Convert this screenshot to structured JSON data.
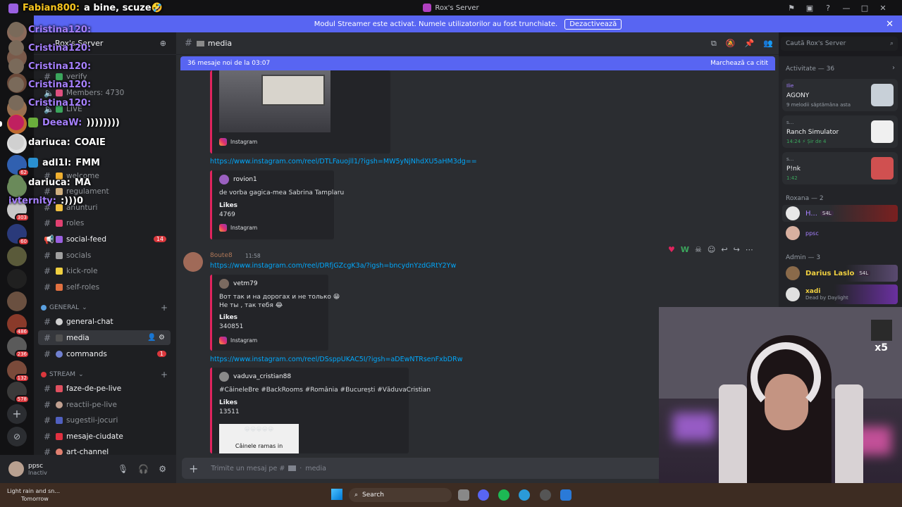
{
  "window": {
    "title": "Rox's Server"
  },
  "banner": {
    "text": "Modul Streamer este activat. Numele utilizatorilor au fost trunchiate.",
    "button": "Dezactivează"
  },
  "server": {
    "name": "Rox's Server"
  },
  "channel_list": {
    "top": [
      {
        "label": "verify"
      },
      {
        "label": "Members: 4730"
      },
      {
        "label": "LIVE"
      },
      {
        "label": "welcome"
      },
      {
        "label": "regulament"
      },
      {
        "label": "anunturi"
      },
      {
        "label": "roles"
      },
      {
        "label": "social-feed",
        "count": "14"
      },
      {
        "label": "socials"
      },
      {
        "label": "kick-role"
      },
      {
        "label": "self-roles"
      }
    ],
    "cat_general": "GENERAL",
    "general": [
      {
        "label": "general-chat"
      },
      {
        "label": "media"
      },
      {
        "label": "commands",
        "count": "1"
      }
    ],
    "cat_stream": "STREAM",
    "stream": [
      {
        "label": "faze-de-pe-live"
      },
      {
        "label": "reactii-pe-live"
      },
      {
        "label": "sugestii-jocuri"
      },
      {
        "label": "mesaje-ciudate"
      },
      {
        "label": "art-channel"
      }
    ]
  },
  "user": {
    "name": "ppsc",
    "status": "Inactiv"
  },
  "chat": {
    "channel": "media",
    "new_messages": "36 mesaje noi de la 03:07",
    "mark_read": "Marchează ca citit",
    "search_placeholder": "Caută Rox's Server",
    "composer_placeholder": "Trimite un mesaj pe #",
    "composer_channel": "media",
    "embed0": {
      "source": "Instagram"
    },
    "link1": "https://www.instagram.com/reel/DTLFauojll1/?igsh=MW5yNjNhdXU5aHM3dg==",
    "embed1": {
      "author": "rovion1",
      "text": "de vorba gagica-mea Sabrina Tamplaru",
      "likes_label": "Likes",
      "likes": "4769",
      "source": "Instagram"
    },
    "msg2": {
      "author": "8oute8",
      "time": "11:58"
    },
    "link2": "https://www.instagram.com/reel/DRfjGZcgK3a/?igsh=bncydnYzdGRtY2Yw",
    "embed2": {
      "author": "vetm79",
      "line1": "Вот так и на дорогах и не только 😁",
      "line2": "Не ты , так тебя 😂",
      "likes_label": "Likes",
      "likes": "340851",
      "source": "Instagram"
    },
    "link3": "https://www.instagram.com/reel/DSsppUKAC5I/?igsh=aDEwNTRsenFxbDRw",
    "embed3": {
      "author": "vaduva_cristian88",
      "text": "#CăineleBre #BackRooms #România #București #VăduvaCristian",
      "likes_label": "Likes",
      "likes": "13511",
      "thumb_emojis": "😀😀😀😀😀",
      "thumb_caption": "Câinele ramas in"
    }
  },
  "members": {
    "activity_header": "Activitate — 36",
    "activities": [
      {
        "user": "Ilie",
        "title": "AGONY",
        "sub": "9 melodii săptămâna asta"
      },
      {
        "user": "s...",
        "title": "Ranch Simulator",
        "sub": "14:24  ⚡ Șir de 4"
      },
      {
        "user": "s...",
        "title": "P!nk",
        "sub": "1:42"
      }
    ],
    "group1": "Roxana — 2",
    "group1_tag": "S4L",
    "group1_m2": "ppsc",
    "group2": "Admin — 3",
    "admin1": "Darius Laslo",
    "admin1_tag": "S4L",
    "admin2": "xadi",
    "admin2_sub": "Dead by Daylight"
  },
  "overlay": [
    {
      "name": "Fabian800:",
      "msg": "a bine, scuze🤣"
    },
    {
      "name": "Cristina120:",
      "msg": ""
    },
    {
      "name": "Cristina120:",
      "msg": ""
    },
    {
      "name": "Cristina120:",
      "msg": ""
    },
    {
      "name": "Cristina120:",
      "msg": ""
    },
    {
      "name": "Cristina120:",
      "msg": ""
    },
    {
      "name": "DeeaW:",
      "msg": "))))))))"
    },
    {
      "name": "dariuca:",
      "msg": "COAIE"
    },
    {
      "name": "adl1l:",
      "msg": "FMM"
    },
    {
      "name": "dariuca:",
      "msg": "MA"
    },
    {
      "name": "ivternity:",
      "msg": ":)))0"
    }
  ],
  "server_badges": [
    "62",
    "303",
    "60",
    "486",
    "236",
    "132",
    "578",
    "51"
  ],
  "taskbar": {
    "weather": "Light rain and sn...",
    "weather_sub": "Tomorrow",
    "search": "Search"
  },
  "webcam": {
    "label": "x5"
  }
}
